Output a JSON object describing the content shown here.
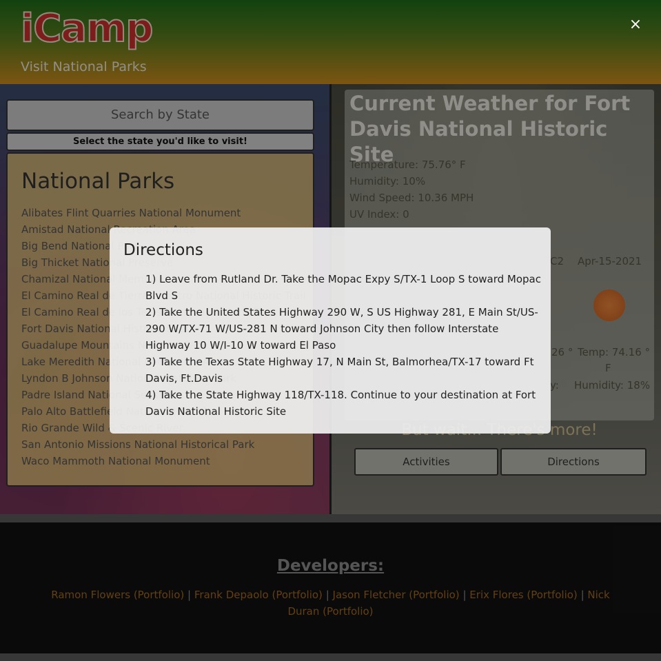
{
  "header": {
    "logo": "iCamp",
    "tagline": "Visit National Parks"
  },
  "search": {
    "placeholder": "Search by State",
    "hint": "Select the state you'd like to visit!"
  },
  "parks": {
    "title": "National Parks",
    "items": [
      "Alibates Flint Quarries National Monument",
      "Amistad National Recreation Area",
      "Big Bend National Park",
      "Big Thicket National Preserve",
      "Chamizal National Memorial",
      "El Camino Real de Tierra Adentro National Historic Trail",
      "El Camino Real de los Tejas National Historic Trail",
      "Fort Davis National Historic Site",
      "Guadalupe Mountains National Park",
      "Lake Meredith National Recreation Area",
      "Lyndon B Johnson National Historical Park",
      "Padre Island National Seashore",
      "Palo Alto Battlefield National Historical Park",
      "Rio Grande Wild & Scenic River",
      "San Antonio Missions National Historical Park",
      "Waco Mammoth National Monument"
    ]
  },
  "weather": {
    "title": "Current Weather for Fort Davis National Historic Site",
    "temperature": "Temperature: 75.76° F",
    "humidity": "Humidity: 10%",
    "wind": "Wind Speed: 10.36 MPH",
    "uv": "UV Index: 0",
    "forecast": {
      "c2": "C2",
      "date": "Apr-15-2021",
      "temp_a": "26 °",
      "temp_b": "Temp: 74.16 °",
      "unit_f": "F",
      "humidity_a": "y:",
      "humidity_b": "Humidity: 18%"
    },
    "more_text": "But wait... There's more!",
    "activities_button": "Activities",
    "directions_button": "Directions"
  },
  "footer": {
    "heading": "Developers:",
    "developers": [
      "Ramon Flowers (Portfolio)",
      "Frank Depaolo (Portfolio)",
      "Jason Fletcher (Portfolio)",
      "Erix Flores (Portfolio)",
      "Nick Duran (Portfolio)"
    ],
    "separator": "|"
  },
  "modal": {
    "close": "×",
    "title": "Directions",
    "steps": [
      "1) Leave from Rutland Dr. Take the Mopac Expy S/TX-1 Loop S toward Mopac Blvd S",
      "2) Take the United States Highway 290 W, S US Highway 281, E Main St/US-290 W/TX-71 W/US-281 N toward Johnson City then follow Interstate Highway 10 W/I-10 W toward El Paso",
      "3) Take the Texas State Highway 17, N Main St, Balmorhea/TX-17 toward Ft Davis, Ft.Davis",
      "4) Take the State Highway 118/TX-118. Continue to your destination at Fort Davis National Historic Site"
    ]
  },
  "colors": {
    "accent_link": "#a06820",
    "logo_red": "#c9302c",
    "footer_bg": "#111111"
  }
}
